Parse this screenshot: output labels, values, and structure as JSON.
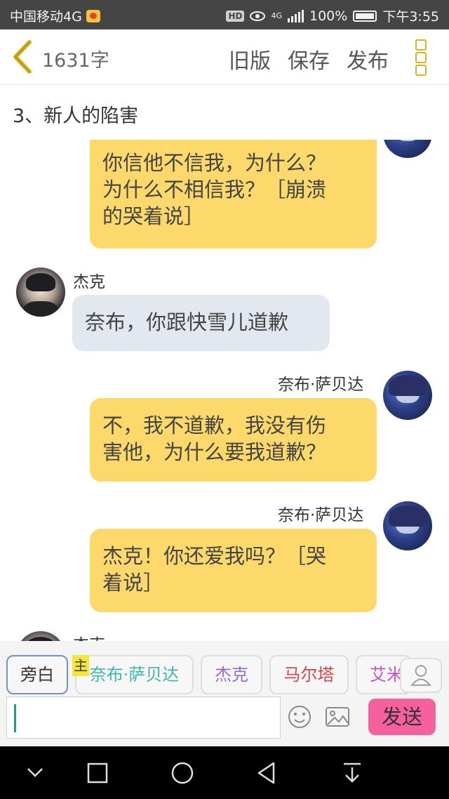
{
  "status_bar": {
    "carrier": "中国移动4G",
    "hd": "HD",
    "network": "4G",
    "battery": "100%",
    "time": "下午3:55"
  },
  "header": {
    "word_count": "1631字",
    "old_version": "旧版",
    "save": "保存",
    "publish": "发布",
    "icons": {
      "back": "chevron-left-icon",
      "menu": "more-vertical-icon"
    },
    "accent_color": "#d9b420"
  },
  "chapter": {
    "title": "3、新人的陷害"
  },
  "messages": [
    {
      "speaker": "",
      "side": "right",
      "text": "你信他不信我，为什么？\n为什么不相信我？［崩溃\n的哭着说］"
    },
    {
      "speaker": "杰克",
      "side": "left",
      "text": "奈布，你跟快雪儿道歉"
    },
    {
      "speaker": "奈布·萨贝达",
      "side": "right",
      "text": "不，我不道歉，我没有伤\n害他，为什么要我道歉？"
    },
    {
      "speaker": "奈布·萨贝达",
      "side": "right",
      "text": "杰克！你还爱我吗？［哭\n着说］"
    },
    {
      "speaker": "杰克",
      "side": "left",
      "text": ""
    }
  ],
  "roles": [
    {
      "label": "旁白",
      "color": "#666666",
      "active": true
    },
    {
      "label": "奈布·萨贝达",
      "color": "#3fb5b0",
      "tag": "主"
    },
    {
      "label": "杰克",
      "color": "#9a6ec4"
    },
    {
      "label": "马尔塔",
      "color": "#d64545"
    },
    {
      "label": "艾米",
      "color": "#c452c4"
    }
  ],
  "input": {
    "value": "",
    "send": "发送",
    "send_color": "#f6609c"
  },
  "nav": {
    "icons": [
      "chevron-down-icon",
      "square-icon",
      "circle-icon",
      "triangle-back-icon",
      "download-arrow-icon"
    ]
  }
}
